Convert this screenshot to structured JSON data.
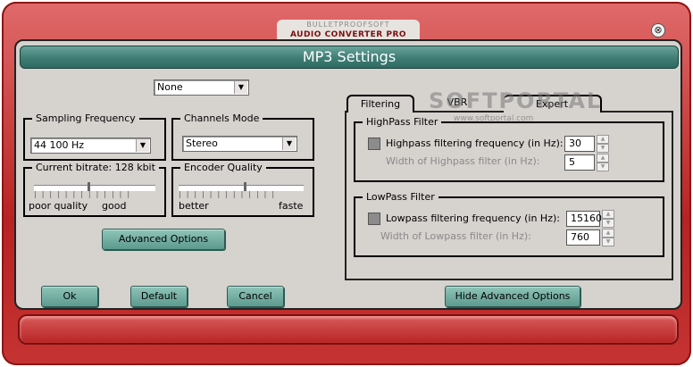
{
  "window": {
    "brand_top": "BULLETPROOFSOFT",
    "brand_bottom": "AUDIO CONVERTER PRO",
    "close_glyph": "⊗",
    "title": "MP3 Settings"
  },
  "preset": {
    "selected": "None"
  },
  "sampling": {
    "legend": "Sampling Frequency",
    "selected": "44 100 Hz"
  },
  "channels": {
    "legend": "Channels Mode",
    "selected": "Stereo"
  },
  "bitrate": {
    "legend": "Current bitrate: 128 kbit",
    "left_label": "poor quality",
    "right_label": "good",
    "level": 0.45
  },
  "quality": {
    "legend": "Encoder Quality",
    "left_label": "better",
    "right_label": "faste",
    "level": 0.53
  },
  "advanced_button": "Advanced Options",
  "tabs": [
    "Filtering",
    "VBR",
    "Expert"
  ],
  "highpass": {
    "legend": "HighPass Filter",
    "check_label": "Highpass filtering frequency (in Hz):",
    "freq": "30",
    "width_label": "Width of Highpass filter (in Hz):",
    "width": "5"
  },
  "lowpass": {
    "legend": "LowPass Filter",
    "check_label": "Lowpass filtering frequency (in Hz):",
    "freq": "15160",
    "width_label": "Width of Lowpass filter (in Hz):",
    "width": "760"
  },
  "buttons": {
    "ok": "Ok",
    "default": "Default",
    "cancel": "Cancel",
    "hide_advanced": "Hide Advanced Options"
  },
  "watermark": {
    "main": "SOFTPORTAL",
    "sub": "www.softportal.com"
  },
  "colors": {
    "frame": "#c53333",
    "title_bar": "#3e7d74",
    "button": "#7bb3a8",
    "panel": "#d6d2ce"
  }
}
